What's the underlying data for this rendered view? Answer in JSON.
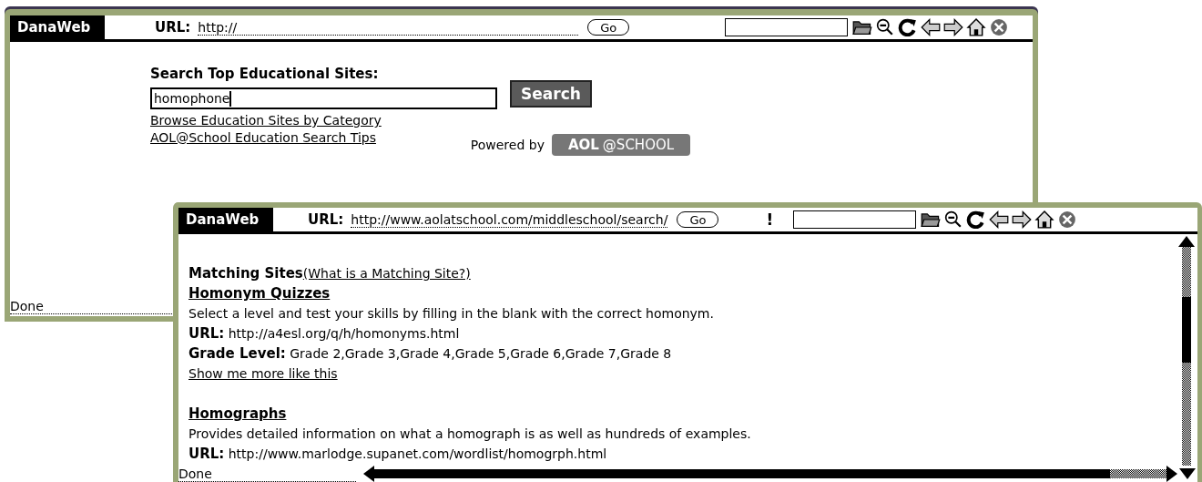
{
  "windows": [
    {
      "kind": "home",
      "tab": "DanaWeb",
      "url_label": "URL:",
      "url": "http://",
      "go": "Go",
      "status": "Done",
      "content": {
        "heading": "Search Top Educational Sites:",
        "search_value": "homophone",
        "search_button": "Search",
        "links": [
          "Browse Education Sites by Category",
          "AOL@School Education Search Tips"
        ],
        "powered_by": "Powered by",
        "logo": {
          "left": "AOL",
          "right": "@SCHOOL"
        }
      }
    },
    {
      "kind": "results",
      "tab": "DanaWeb",
      "url_label": "URL:",
      "url": "http://www.aolatschool.com/middleschool/search/",
      "go": "Go",
      "indicator": "!",
      "status": "Done",
      "content": {
        "section_title": "Matching Sites",
        "section_link": "(What is a Matching Site?)",
        "results": [
          {
            "title": "Homonym Quizzes",
            "description": "Select a level and test your skills by filling in the blank with the correct homonym.",
            "url_label": "URL:",
            "url": "http://a4esl.org/q/h/homonyms.html",
            "grade_label": "Grade Level:",
            "grade": "Grade 2,Grade 3,Grade 4,Grade 5,Grade 6,Grade 7,Grade 8",
            "more_link": "Show me more like this"
          },
          {
            "title": "Homographs",
            "description": "Provides detailed information on what a homograph is as well as hundreds of examples.",
            "url_label": "URL:",
            "url": "http://www.marlodge.supanet.com/wordlist/homogrph.html"
          }
        ]
      }
    }
  ]
}
